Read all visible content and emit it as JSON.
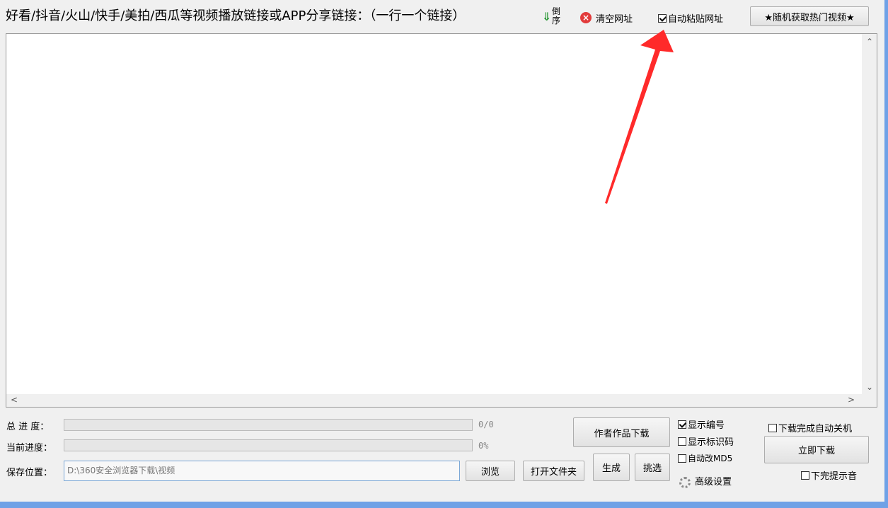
{
  "header": {
    "instruction": "好看/抖音/火山/快手/美拍/西瓜等视频播放链接或APP分享链接：（一行一个链接）",
    "sort_label": "倒序",
    "clear_label": "清空网址",
    "auto_paste_label": "自动粘贴网址",
    "auto_paste_checked": true,
    "hot_video_label": "★随机获取热门视频★"
  },
  "url_list": {
    "value": ""
  },
  "progress": {
    "total_label": "总 进 度：",
    "total_value": "0/0",
    "total_fraction": 0,
    "current_label": "当前进度：",
    "current_value": "0%",
    "current_fraction": 0
  },
  "save": {
    "label": "保存位置：",
    "path": "D:\\360安全浏览器下载\\视频",
    "browse_label": "浏览",
    "open_folder_label": "打开文件夹"
  },
  "actions": {
    "author_download_label": "作者作品下载",
    "generate_label": "生成",
    "select_label": "挑选",
    "advanced_label": "高级设置",
    "download_now_label": "立即下载"
  },
  "options": {
    "show_number_label": "显示编号",
    "show_number_checked": true,
    "show_id_label": "显示标识码",
    "show_id_checked": false,
    "auto_md5_label": "自动改MD5",
    "auto_md5_checked": false,
    "shutdown_label": "下载完成自动关机",
    "shutdown_checked": false,
    "sound_label": "下完提示音",
    "sound_checked": false
  },
  "colors": {
    "arrow": "#ff2a2a",
    "window_bg": "#f0f0f0",
    "frame": "#6fa1e6"
  }
}
